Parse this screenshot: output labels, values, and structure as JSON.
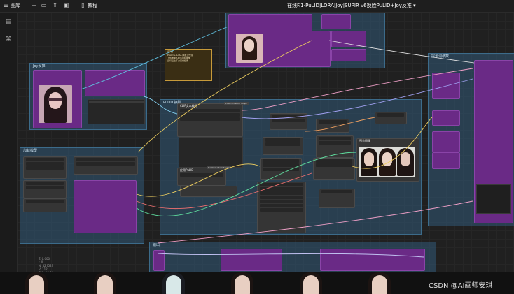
{
  "topbar": {
    "menu_label": "图库",
    "tutorial_label": "教程",
    "workflow_title": "在线F.1-PuLID|LORA|Joy|SUPIR v6换脸PuLID+Joy反推 ▾"
  },
  "sidebar": {
    "icons": [
      "document-icon",
      "sitemap-icon"
    ]
  },
  "canvas": {
    "groups": {
      "load_image": "Joy反推",
      "model_group": "加载模型",
      "main_group": "PuLID 换脸",
      "right_group": "提示词参数",
      "bottom_group": "输出"
    },
    "note": {
      "title": "说明",
      "lines": [
        "PuLID + LoRA 换脸工作流",
        "上传参考人脸与目标图像",
        "运行后在下方查看结果"
      ]
    },
    "nodes": {
      "custom_script_a": "PuLID Custom Script",
      "custom_script_b": "PuLID Custom Script",
      "node_label_a": "CLIP文本编码",
      "node_label_b": "应用PuLID",
      "node_label_c": "预览图像"
    },
    "info_lines": "T: 0.000\nI: 0\nN: 52 [52]\nV: 112\nFPS: 18.16"
  },
  "watermark": "CSDN @AI画师安琪"
}
